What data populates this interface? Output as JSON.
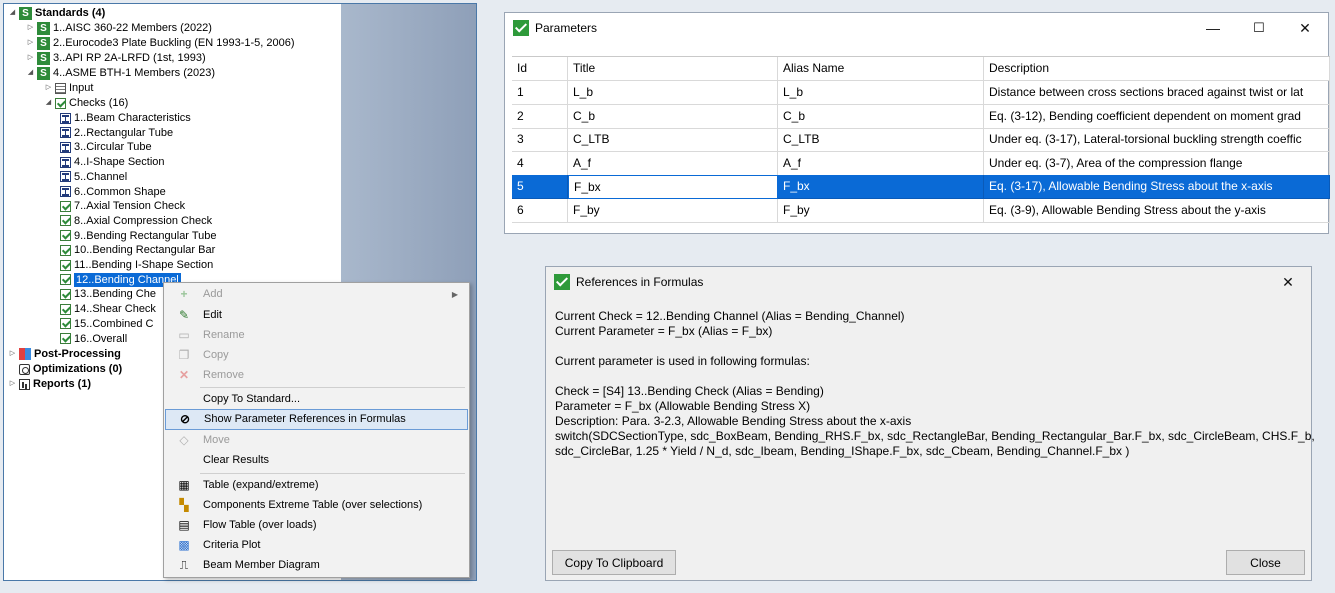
{
  "tree": {
    "standards": {
      "label": "Standards (4)"
    },
    "std1": {
      "label": "1..AISC 360-22 Members (2022)"
    },
    "std2": {
      "label": "2..Eurocode3 Plate Buckling (EN 1993-1-5, 2006)"
    },
    "std3": {
      "label": "3..API RP 2A-LRFD (1st, 1993)"
    },
    "std4": {
      "label": "4..ASME BTH-1 Members (2023)"
    },
    "input": {
      "label": "Input"
    },
    "checks": {
      "label": "Checks (16)"
    },
    "check_items": [
      {
        "label": "1..Beam Characteristics",
        "icon": "ibeam"
      },
      {
        "label": "2..Rectangular Tube",
        "icon": "ibeam"
      },
      {
        "label": "3..Circular Tube",
        "icon": "ibeam"
      },
      {
        "label": "4..I-Shape Section",
        "icon": "ibeam"
      },
      {
        "label": "5..Channel",
        "icon": "ibeam"
      },
      {
        "label": "6..Common Shape",
        "icon": "ibeam"
      },
      {
        "label": "7..Axial Tension Check",
        "icon": "check"
      },
      {
        "label": "8..Axial Compression Check",
        "icon": "check"
      },
      {
        "label": "9..Bending Rectangular Tube",
        "icon": "check"
      },
      {
        "label": "10..Bending Rectangular Bar",
        "icon": "check"
      },
      {
        "label": "11..Bending I-Shape Section",
        "icon": "check"
      },
      {
        "label": "12..Bending Channel",
        "icon": "check"
      },
      {
        "label": "13..Bending Che",
        "icon": "check"
      },
      {
        "label": "14..Shear Check",
        "icon": "check"
      },
      {
        "label": "15..Combined C",
        "icon": "check"
      },
      {
        "label": "16..Overall",
        "icon": "check"
      }
    ],
    "post_processing": {
      "label": "Post-Processing"
    },
    "optimizations": {
      "label": "Optimizations (0)"
    },
    "reports": {
      "label": "Reports (1)"
    }
  },
  "context_menu": {
    "items": [
      {
        "label": "Add",
        "enabled": false
      },
      {
        "label": "Edit",
        "enabled": true
      },
      {
        "label": "Rename",
        "enabled": false
      },
      {
        "label": "Copy",
        "enabled": false
      },
      {
        "label": "Remove",
        "enabled": false
      },
      {
        "label": "Copy To Standard...",
        "enabled": true
      },
      {
        "label": "Show Parameter References in Formulas",
        "enabled": true
      },
      {
        "label": "Move",
        "enabled": false
      },
      {
        "label": "Clear Results",
        "enabled": true
      },
      {
        "label": "Table (expand/extreme)",
        "enabled": true
      },
      {
        "label": "Components Extreme Table (over selections)",
        "enabled": true
      },
      {
        "label": "Flow Table (over loads)",
        "enabled": true
      },
      {
        "label": "Criteria Plot",
        "enabled": true
      },
      {
        "label": "Beam Member Diagram",
        "enabled": true
      }
    ]
  },
  "parameters_window": {
    "title": "Parameters",
    "minimize": "—",
    "maximize": "☐",
    "close": "✕",
    "columns": [
      "Id",
      "Title",
      "Alias Name",
      "Description"
    ],
    "rows": [
      [
        "1",
        "L_b",
        "L_b",
        "Distance between cross sections braced against twist or lat"
      ],
      [
        "2",
        "C_b",
        "C_b",
        "Eq. (3-12), Bending coefficient dependent on moment grad"
      ],
      [
        "3",
        "C_LTB",
        "C_LTB",
        "Under eq. (3-17), Lateral-torsional buckling strength coeffic"
      ],
      [
        "4",
        "A_f",
        "A_f",
        "Under eq. (3-7), Area of the compression flange"
      ],
      [
        "5",
        "F_bx",
        "F_bx",
        "Eq. (3-17), Allowable Bending Stress about the x-axis"
      ],
      [
        "6",
        "F_by",
        "F_by",
        "Eq. (3-9), Allowable Bending Stress about the y-axis"
      ]
    ],
    "selected_row": 4
  },
  "references_window": {
    "title": "References in Formulas",
    "close": "✕",
    "lines": [
      "Current Check = 12..Bending Channel (Alias = Bending_Channel)",
      "Current Parameter = F_bx (Alias = F_bx)",
      "",
      "Current parameter is used in following formulas:",
      "",
      "Check = [S4] 13..Bending Check (Alias = Bending)",
      "Parameter = F_bx (Allowable Bending Stress X)",
      "Description: Para. 3-2.3, Allowable Bending Stress about the x-axis",
      "switch(SDCSectionType, sdc_BoxBeam, Bending_RHS.F_bx, sdc_RectangleBar, Bending_Rectangular_Bar.F_bx, sdc_CircleBeam, CHS.F_b,",
      "sdc_CircleBar, 1.25 * Yield / N_d, sdc_Ibeam, Bending_IShape.F_bx, sdc_Cbeam, Bending_Channel.F_bx )"
    ],
    "copy_button": "Copy To Clipboard",
    "close_button": "Close"
  }
}
